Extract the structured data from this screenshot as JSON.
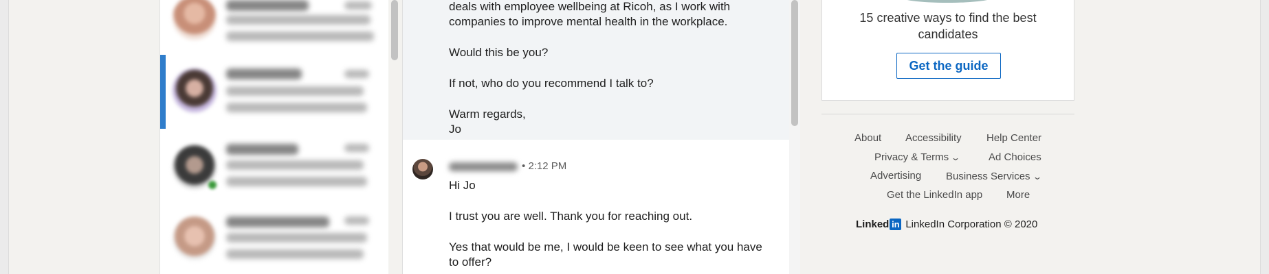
{
  "thread": {
    "own_message_lines": [
      "deals with employee wellbeing at Ricoh, as I work with",
      "companies to improve mental health in the workplace.",
      "Would this be you?",
      "If not, who do you recommend I talk to?",
      "Warm regards,",
      "Jo"
    ],
    "reply": {
      "separator": "•",
      "time": "2:12 PM",
      "lines": [
        "Hi Jo",
        "I trust you are well. Thank you for reaching out.",
        "Yes that would be me, I would be keen to see what you have",
        "to offer?"
      ]
    }
  },
  "ad": {
    "line1": "15 creative ways to find the best",
    "line2": "candidates",
    "button_label": "Get the guide"
  },
  "footer": {
    "links": {
      "about": "About",
      "accessibility": "Accessibility",
      "help_center": "Help Center",
      "privacy_terms": "Privacy & Terms",
      "ad_choices": "Ad Choices",
      "advertising": "Advertising",
      "business_services": "Business Services",
      "get_app": "Get the LinkedIn app",
      "more": "More"
    },
    "brand_wordmark": "Linked",
    "brand_in": "in",
    "copyright": "LinkedIn Corporation © 2020"
  },
  "colors": {
    "accent": "#0a66c2",
    "page_bg": "#f3f2ef",
    "own_message_bg": "#f2f4f6"
  },
  "icons": {
    "dropdown": "chevron-down-icon"
  }
}
